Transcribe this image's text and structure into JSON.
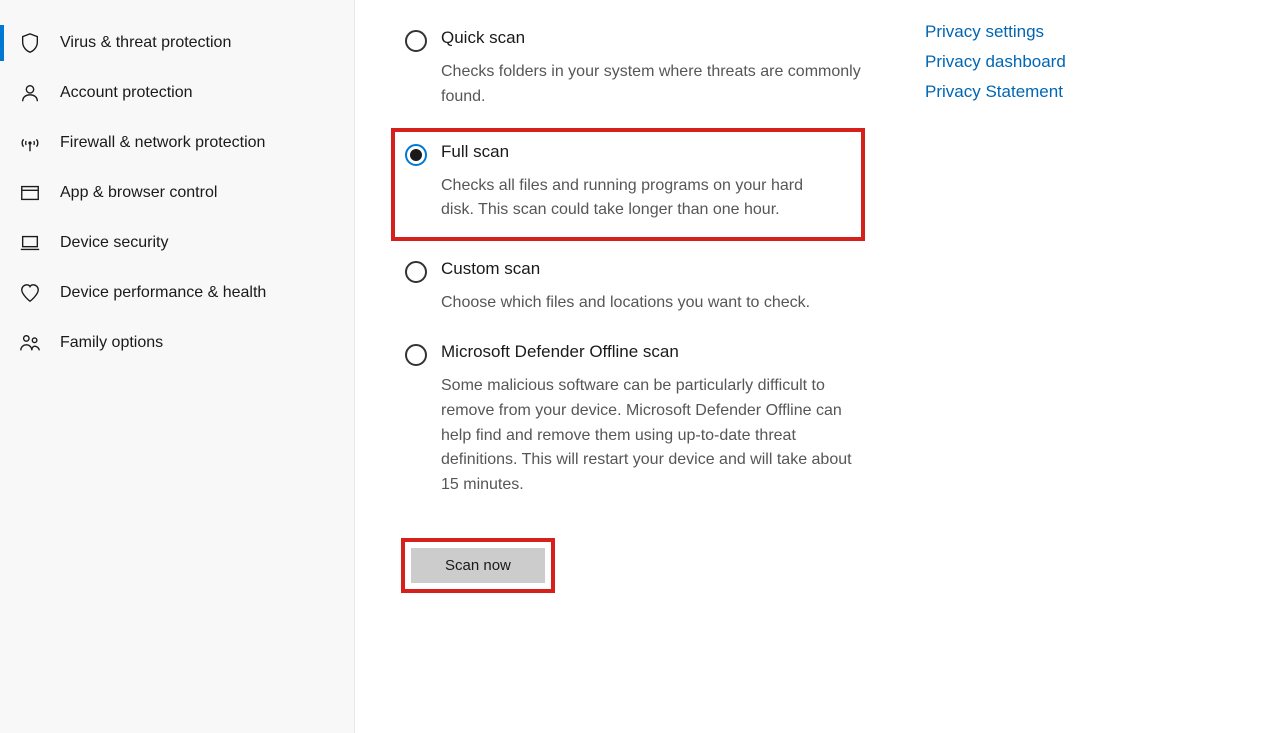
{
  "sidebar": {
    "items": [
      {
        "label": "Virus & threat protection",
        "icon": "shield",
        "active": true
      },
      {
        "label": "Account protection",
        "icon": "person",
        "active": false
      },
      {
        "label": "Firewall & network protection",
        "icon": "antenna",
        "active": false
      },
      {
        "label": "App & browser control",
        "icon": "window",
        "active": false
      },
      {
        "label": "Device security",
        "icon": "laptop",
        "active": false
      },
      {
        "label": "Device performance & health",
        "icon": "heart",
        "active": false
      },
      {
        "label": "Family options",
        "icon": "family",
        "active": false
      }
    ]
  },
  "scanOptions": [
    {
      "title": "Quick scan",
      "desc": "Checks folders in your system where threats are commonly found.",
      "checked": false,
      "highlight": false
    },
    {
      "title": "Full scan",
      "desc": "Checks all files and running programs on your hard disk. This scan could take longer than one hour.",
      "checked": true,
      "highlight": true
    },
    {
      "title": "Custom scan",
      "desc": "Choose which files and locations you want to check.",
      "checked": false,
      "highlight": false
    },
    {
      "title": "Microsoft Defender Offline scan",
      "desc": "Some malicious software can be particularly difficult to remove from your device. Microsoft Defender Offline can help find and remove them using up-to-date threat definitions. This will restart your device and will take about 15 minutes.",
      "checked": false,
      "highlight": false
    }
  ],
  "scanButton": "Scan now",
  "links": [
    "Privacy settings",
    "Privacy dashboard",
    "Privacy Statement"
  ]
}
